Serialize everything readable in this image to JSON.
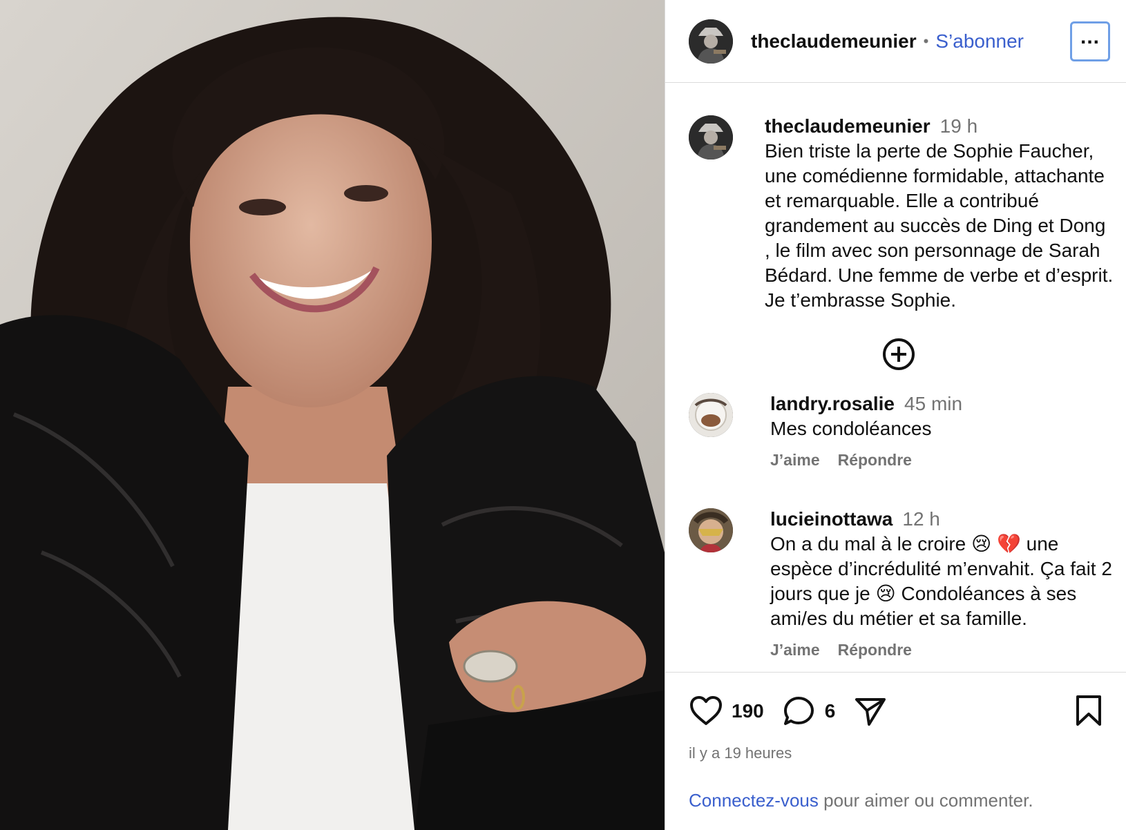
{
  "post": {
    "author": "theclaudemeunier",
    "follow_label": "S’abonner",
    "separator": "•",
    "more_label": "...",
    "caption": {
      "username": "theclaudemeunier",
      "time": "19 h",
      "text": "Bien triste la perte de Sophie Faucher,\nune comédienne formidable, attachante\net remarquable. Elle a contribué\ngrandement au succès de Ding et Dong\n, le film avec son personnage de Sarah\nBédard. Une femme de verbe et d’esprit.\nJe t’embrasse Sophie."
    },
    "load_more_icon": "plus-circle-icon",
    "comments": [
      {
        "username": "landry.rosalie",
        "time": "45 min",
        "text": "Mes condoléances",
        "like_label": "J’aime",
        "reply_label": "Répondre"
      },
      {
        "username": "lucieinottawa",
        "time": "12 h",
        "text_1": "On a du mal à le croire 😢 💔 une",
        "text_2": "espèce d’incrédulité m’envahit. Ça fait 2",
        "text_3": "jours que je 😢 Condoléances à ses",
        "text_4": "ami/es du métier et sa famille.",
        "like_label": "J’aime",
        "reply_label": "Répondre"
      }
    ],
    "actions": {
      "likes": "190",
      "comments": "6",
      "icons": [
        "heart-icon",
        "comment-icon",
        "share-icon",
        "bookmark-icon"
      ]
    },
    "time_ago": "il y a 19 heures",
    "login_link": "Connectez-vous",
    "login_rest": " pour aimer ou commenter."
  },
  "colors": {
    "link": "#3a5fcd",
    "muted": "#737373",
    "border": "#dbdbdb",
    "focus_ring": "#6f9fe6"
  }
}
